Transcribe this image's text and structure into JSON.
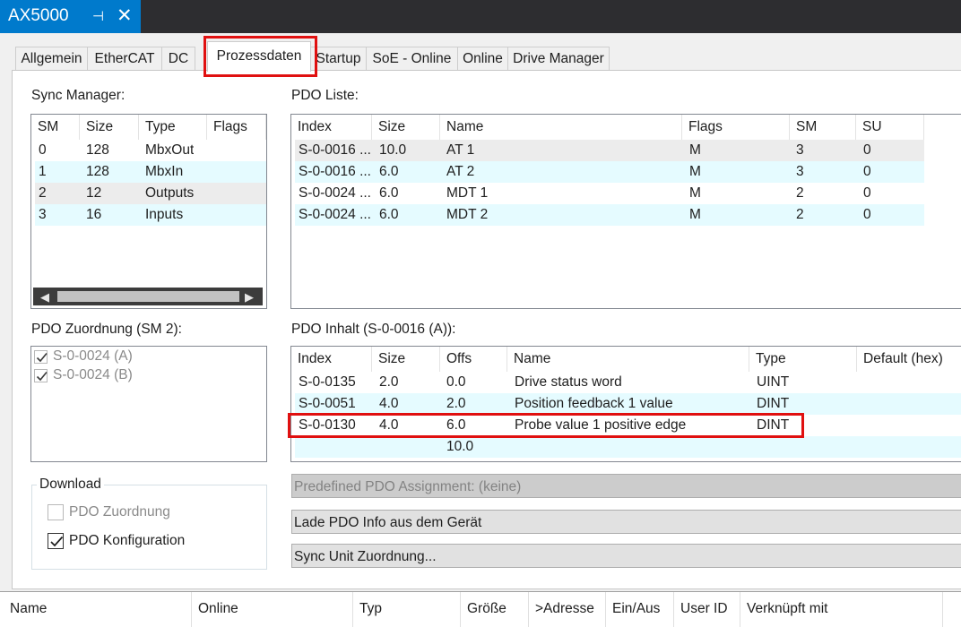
{
  "window": {
    "title": "AX5000",
    "pin_glyph": "⊣",
    "close_glyph": "✕"
  },
  "tabs": [
    "Allgemein",
    "EtherCAT",
    "DC",
    "Prozessdaten",
    "Startup",
    "SoE - Online",
    "Online",
    "Drive Manager"
  ],
  "active_tab": "Prozessdaten",
  "sync_manager": {
    "label": "Sync Manager:",
    "columns": [
      "SM",
      "Size",
      "Type",
      "Flags"
    ],
    "rows": [
      [
        "0",
        "128",
        "MbxOut",
        ""
      ],
      [
        "1",
        "128",
        "MbxIn",
        ""
      ],
      [
        "2",
        "12",
        "Outputs",
        ""
      ],
      [
        "3",
        "16",
        "Inputs",
        ""
      ]
    ],
    "scroll_left": "◀",
    "scroll_right": "▶"
  },
  "pdo_liste": {
    "label": "PDO Liste:",
    "columns": [
      "Index",
      "Size",
      "Name",
      "Flags",
      "SM",
      "SU"
    ],
    "rows": [
      [
        "S-0-0016 ...",
        "10.0",
        "AT 1",
        "M",
        "3",
        "0"
      ],
      [
        "S-0-0016 ...",
        "6.0",
        "AT 2",
        "M",
        "3",
        "0"
      ],
      [
        "S-0-0024 ...",
        "6.0",
        "MDT 1",
        "M",
        "2",
        "0"
      ],
      [
        "S-0-0024 ...",
        "6.0",
        "MDT 2",
        "M",
        "2",
        "0"
      ]
    ]
  },
  "pdo_zuordnung": {
    "label": "PDO Zuordnung (SM 2):",
    "items": [
      {
        "label": "S-0-0024 (A)",
        "checked": true,
        "enabled": false
      },
      {
        "label": "S-0-0024 (B)",
        "checked": true,
        "enabled": false
      }
    ]
  },
  "pdo_inhalt": {
    "label": "PDO Inhalt (S-0-0016 (A)):",
    "columns": [
      "Index",
      "Size",
      "Offs",
      "Name",
      "Type",
      "Default (hex)"
    ],
    "rows": [
      [
        "S-0-0135",
        "2.0",
        "0.0",
        "Drive status word",
        "UINT",
        ""
      ],
      [
        "S-0-0051",
        "4.0",
        "2.0",
        "Position feedback 1 value",
        "DINT",
        ""
      ],
      [
        "S-0-0130",
        "4.0",
        "6.0",
        "Probe value 1 positive edge",
        "DINT",
        ""
      ],
      [
        "",
        "",
        "10.0",
        "",
        "",
        ""
      ]
    ]
  },
  "download": {
    "label": "Download",
    "options": [
      {
        "label": "PDO Zuordnung",
        "checked": false,
        "enabled": false
      },
      {
        "label": "PDO Konfiguration",
        "checked": true,
        "enabled": true
      }
    ]
  },
  "buttons": {
    "predefined": "Predefined PDO Assignment: (keine)",
    "lade": "Lade PDO Info aus dem Gerät",
    "sync_unit": "Sync Unit Zuordnung..."
  },
  "bottom_columns": [
    "Name",
    "Online",
    "Typ",
    "Größe",
    ">Adresse",
    "Ein/Aus",
    "User ID",
    "Verknüpft mit"
  ],
  "colors": {
    "accent": "#007acc",
    "highlight": "#e01010",
    "alt_row": "#e5fbff"
  }
}
